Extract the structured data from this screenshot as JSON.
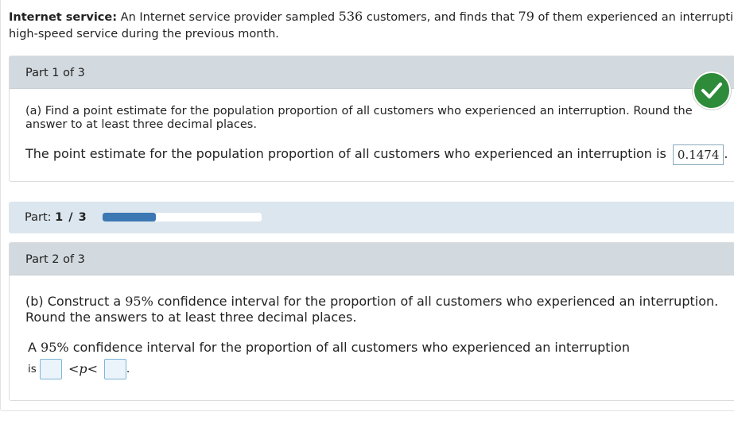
{
  "intro": {
    "label": "Internet service:",
    "text_1": "An Internet service provider sampled",
    "sample_size": "536",
    "text_2": "customers, and finds that",
    "count": "79",
    "text_3": "of them experienced an interruption in",
    "text_4": "high-speed service during the previous month."
  },
  "part1": {
    "header": "Part 1 of 3",
    "question": "(a) Find a point estimate for the population proportion of all customers who experienced an interruption. Round the answer to at least three decimal places.",
    "answer_prefix": "The point estimate for the population proportion of all customers who experienced an interruption is",
    "answer_value": "0.1474",
    "answer_suffix": ".",
    "status_icon": "check-icon",
    "status_color": "#2e8b3a"
  },
  "progress": {
    "label": "Part:",
    "value": "1 / 3",
    "fraction": 0.333
  },
  "part2": {
    "header": "Part 2 of 3",
    "question_prefix": "(b) Construct a",
    "confidence": "95%",
    "question_suffix": "confidence interval for the proportion of all customers who experienced an interruption. Round the answers to at least three decimal places.",
    "answer_prefix_a": "A",
    "answer_confidence": "95%",
    "answer_text": "confidence interval for the proportion of all customers who experienced an interruption",
    "answer_is": "is",
    "lt_1": "<",
    "var": "p",
    "lt_2": "<",
    "lower_value": "",
    "upper_value": "",
    "period": "."
  },
  "colors": {
    "panel_header": "#d3dadf",
    "progress_strip": "#dce6ee",
    "progress_fill": "#3c78b3",
    "input_border": "#7fb5d6"
  }
}
